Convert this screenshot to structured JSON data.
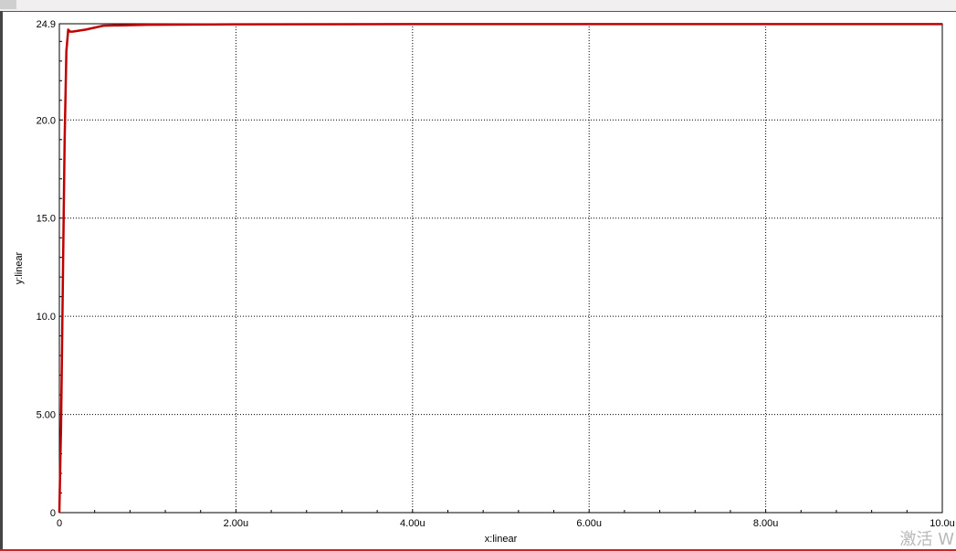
{
  "chart_data": {
    "type": "line",
    "xlabel": "x:linear",
    "ylabel": "y:linear",
    "xlim": [
      0,
      10.0
    ],
    "ylim": [
      0,
      24.9
    ],
    "x_ticks": [
      0,
      2,
      4,
      6,
      8,
      10
    ],
    "x_tick_labels": [
      "0",
      "2.00u",
      "4.00u",
      "6.00u",
      "8.00u",
      "10.0u"
    ],
    "y_ticks": [
      0,
      5,
      10,
      15,
      20,
      24.9
    ],
    "y_tick_labels": [
      "0",
      "5.00",
      "10.0",
      "15.0",
      "20.0",
      "24.9"
    ],
    "grid": true,
    "series": [
      {
        "color": "#c00000",
        "x": [
          0,
          0.02,
          0.04,
          0.06,
          0.08,
          0.1,
          0.12,
          0.15,
          0.3,
          0.5,
          1.0,
          2.0,
          4.0,
          6.0,
          8.0,
          10.0
        ],
        "y": [
          0,
          4.5,
          12.0,
          19.0,
          23.5,
          24.6,
          24.5,
          24.5,
          24.6,
          24.8,
          24.85,
          24.87,
          24.88,
          24.88,
          24.88,
          24.88
        ]
      }
    ]
  },
  "watermark": "激活 W"
}
